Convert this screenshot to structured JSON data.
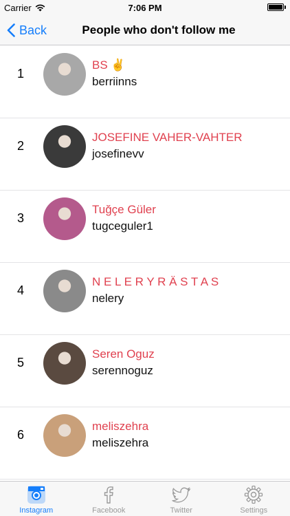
{
  "status_bar": {
    "carrier": "Carrier",
    "time": "7:06 PM"
  },
  "nav": {
    "back_label": "Back",
    "title": "People who don't follow me"
  },
  "people": [
    {
      "number": "1",
      "name": "BS ✌️",
      "username": "berriinns",
      "avatar_color": "#a8a8a8"
    },
    {
      "number": "2",
      "name": "JOSEFINE VAHER-VAHTER",
      "username": "josefinevv",
      "avatar_color": "#3a3a3a"
    },
    {
      "number": "3",
      "name": "Tuğçe Güler",
      "username": "tugceguler1",
      "avatar_color": "#b45a8c"
    },
    {
      "number": "4",
      "name": "N E L E R Y   R Ä S T A S",
      "username": "nelery",
      "avatar_color": "#8a8a8a"
    },
    {
      "number": "5",
      "name": "Seren Oguz",
      "username": "serennoguz",
      "avatar_color": "#5a4a40"
    },
    {
      "number": "6",
      "name": "meliszehra",
      "username": "meliszehra",
      "avatar_color": "#c9a07a"
    }
  ],
  "tabs": [
    {
      "label": "Instagram",
      "icon": "instagram-icon",
      "active": true
    },
    {
      "label": "Facebook",
      "icon": "facebook-icon",
      "active": false
    },
    {
      "label": "Twitter",
      "icon": "twitter-icon",
      "active": false
    },
    {
      "label": "Settings",
      "icon": "gear-icon",
      "active": false
    }
  ],
  "colors": {
    "accent": "#157efb",
    "name": "#e0414f",
    "inactive": "#9a9a9a"
  }
}
